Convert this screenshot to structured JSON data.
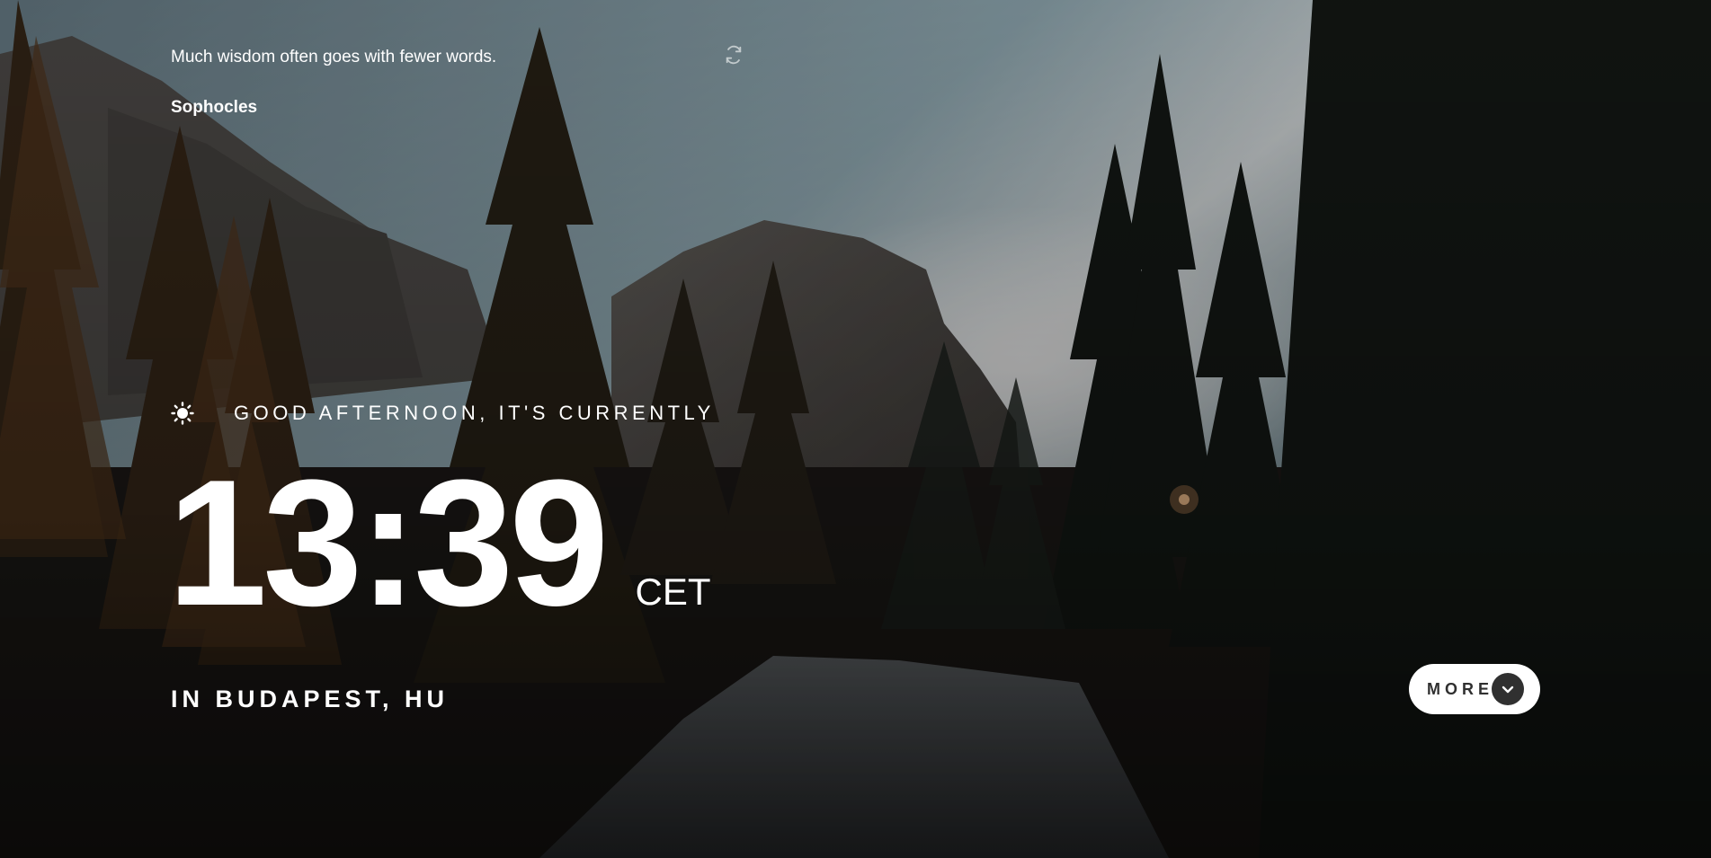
{
  "quote": {
    "text": "Much wisdom often goes with fewer words.",
    "author": "Sophocles",
    "refresh_icon": "refresh-icon"
  },
  "greeting": {
    "icon": "sun-icon",
    "text": "Good afternoon, it's currently"
  },
  "clock": {
    "time": "13:39",
    "timezone": "CET"
  },
  "location": {
    "text": "In Budapest, HU"
  },
  "more_button": {
    "label": "MORE",
    "icon": "chevron-down-icon"
  },
  "colors": {
    "text": "#ffffff",
    "button_bg": "#ffffff",
    "button_text": "#303030",
    "button_icon_bg": "#303030"
  }
}
